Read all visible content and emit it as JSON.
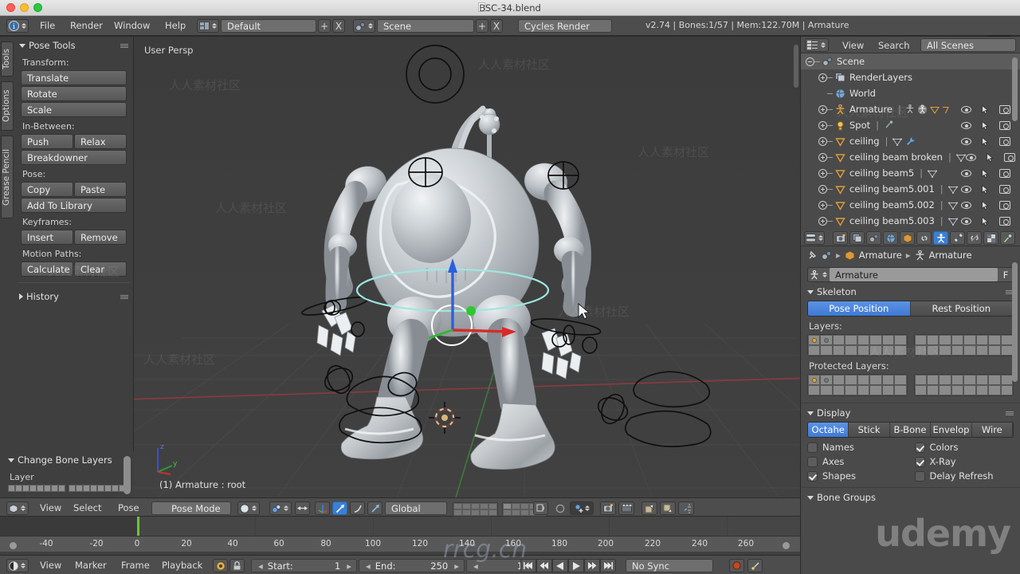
{
  "window": {
    "title": "BSC-34.blend"
  },
  "topbar": {
    "menus": [
      "File",
      "Render",
      "Window",
      "Help"
    ],
    "screen_layout": "Default",
    "scene": "Scene",
    "render_engine": "Cycles Render",
    "status": "v2.74 | Bones:1/57 | Mem:122.70M | Armature",
    "badge": "g",
    "add_label": "+",
    "remove_label": "X"
  },
  "left_tabs": [
    "Tools",
    "Options",
    "Grease Pencil"
  ],
  "tool_panel": {
    "title": "Pose Tools",
    "groups": [
      {
        "label": "Transform:",
        "rows": [
          [
            "Translate"
          ],
          [
            "Rotate"
          ],
          [
            "Scale"
          ]
        ]
      },
      {
        "label": "In-Between:",
        "rows": [
          [
            "Push",
            "Relax"
          ],
          [
            "Breakdowner"
          ]
        ]
      },
      {
        "label": "Pose:",
        "rows": [
          [
            "Copy",
            "Paste"
          ],
          [
            "Add To Library"
          ]
        ]
      },
      {
        "label": "Keyframes:",
        "rows": [
          [
            "Insert",
            "Remove"
          ]
        ]
      },
      {
        "label": "Motion Paths:",
        "rows": [
          [
            "Calculate",
            "Clear"
          ]
        ]
      }
    ],
    "history_title": "History"
  },
  "bone_layers_panel": {
    "title": "Change Bone Layers",
    "layer_label": "Layer"
  },
  "viewport": {
    "view_label": "User Persp",
    "object_label": "(1) Armature : root",
    "axis": {
      "z": "z",
      "y": "y",
      "x": "x"
    }
  },
  "viewport_footer": {
    "menus": [
      "View",
      "Select",
      "Pose"
    ],
    "mode": "Pose Mode",
    "transform_orientation": "Global"
  },
  "timeline": {
    "ticks": [
      -40,
      -20,
      0,
      20,
      40,
      60,
      80,
      100,
      120,
      140,
      160,
      180,
      200,
      220,
      240,
      260
    ],
    "menus": [
      "View",
      "Marker",
      "Frame",
      "Playback"
    ],
    "start_label": "Start:",
    "start_value": "1",
    "end_label": "End:",
    "end_value": "250",
    "current_frame": "1",
    "sync_mode": "No Sync"
  },
  "outliner": {
    "menus": [
      "View",
      "Search"
    ],
    "display_mode": "All Scenes",
    "rows": [
      {
        "label": "Scene",
        "indent": 0,
        "icon": "scene-icon",
        "expander": "minus",
        "selected": true,
        "restrict": false
      },
      {
        "label": "RenderLayers",
        "indent": 1,
        "icon": "renderlayers-icon",
        "expander": "plus",
        "selected": false,
        "restrict": false
      },
      {
        "label": "World",
        "indent": 1,
        "icon": "world-icon",
        "expander": "none",
        "selected": false,
        "restrict": false
      },
      {
        "label": "Armature",
        "indent": 1,
        "icon": "armature-icon",
        "expander": "plus",
        "selected": false,
        "restrict": true
      },
      {
        "label": "Spot",
        "indent": 1,
        "icon": "light-icon",
        "expander": "plus",
        "selected": false,
        "restrict": true
      },
      {
        "label": "ceiling",
        "indent": 1,
        "icon": "mesh-icon",
        "expander": "plus",
        "selected": false,
        "restrict": true
      },
      {
        "label": "ceiling beam broken",
        "indent": 1,
        "icon": "mesh-icon",
        "expander": "plus",
        "selected": false,
        "restrict": true
      },
      {
        "label": "ceiling beam5",
        "indent": 1,
        "icon": "mesh-icon",
        "expander": "plus",
        "selected": false,
        "restrict": true
      },
      {
        "label": "ceiling beam5.001",
        "indent": 1,
        "icon": "mesh-icon",
        "expander": "plus",
        "selected": false,
        "restrict": true
      },
      {
        "label": "ceiling beam5.002",
        "indent": 1,
        "icon": "mesh-icon",
        "expander": "plus",
        "selected": false,
        "restrict": true
      },
      {
        "label": "ceiling beam5.003",
        "indent": 1,
        "icon": "mesh-icon",
        "expander": "plus",
        "selected": false,
        "restrict": true
      }
    ]
  },
  "properties": {
    "tabs": [
      "render-tab",
      "renderlayers-tab",
      "scene-tab",
      "world-tab",
      "object-tab",
      "constraints-tab",
      "armature-tab",
      "bone-tab",
      "bone-constraints-tab",
      "texture-tab",
      "particles-tab"
    ],
    "active_tab": "armature-tab",
    "breadcrumb": [
      "Armature",
      "Armature"
    ],
    "datablock_name": "Armature",
    "datablock_fake_user": "F",
    "skeleton": {
      "title": "Skeleton",
      "position_options": [
        "Pose Position",
        "Rest Position"
      ],
      "position_active": "Pose Position",
      "layers_label": "Layers:",
      "protected_layers_label": "Protected Layers:"
    },
    "display": {
      "title": "Display",
      "type_options": [
        "Octahe",
        "Stick",
        "B-Bone",
        "Envelop",
        "Wire"
      ],
      "type_active": "Octahe",
      "checkboxes": [
        {
          "label": "Names",
          "checked": false
        },
        {
          "label": "Colors",
          "checked": true
        },
        {
          "label": "Axes",
          "checked": false
        },
        {
          "label": "X-Ray",
          "checked": true
        },
        {
          "label": "Shapes",
          "checked": true
        },
        {
          "label": "Delay Refresh",
          "checked": false
        }
      ]
    },
    "bone_groups_title": "Bone Groups"
  },
  "watermarks": {
    "site": "人人素材社区",
    "brand": "udemy",
    "center": "rrcg.cn"
  },
  "colors": {
    "accent_blue": "#3f79d4",
    "panel_bg": "#4a4a4a",
    "tool_bg": "#3f3f3f",
    "viewport_bg": "#3c3c3c",
    "header_bg": "#4d4d4d",
    "playhead_green": "#6ec437",
    "orange_icon": "#e8a33d"
  }
}
